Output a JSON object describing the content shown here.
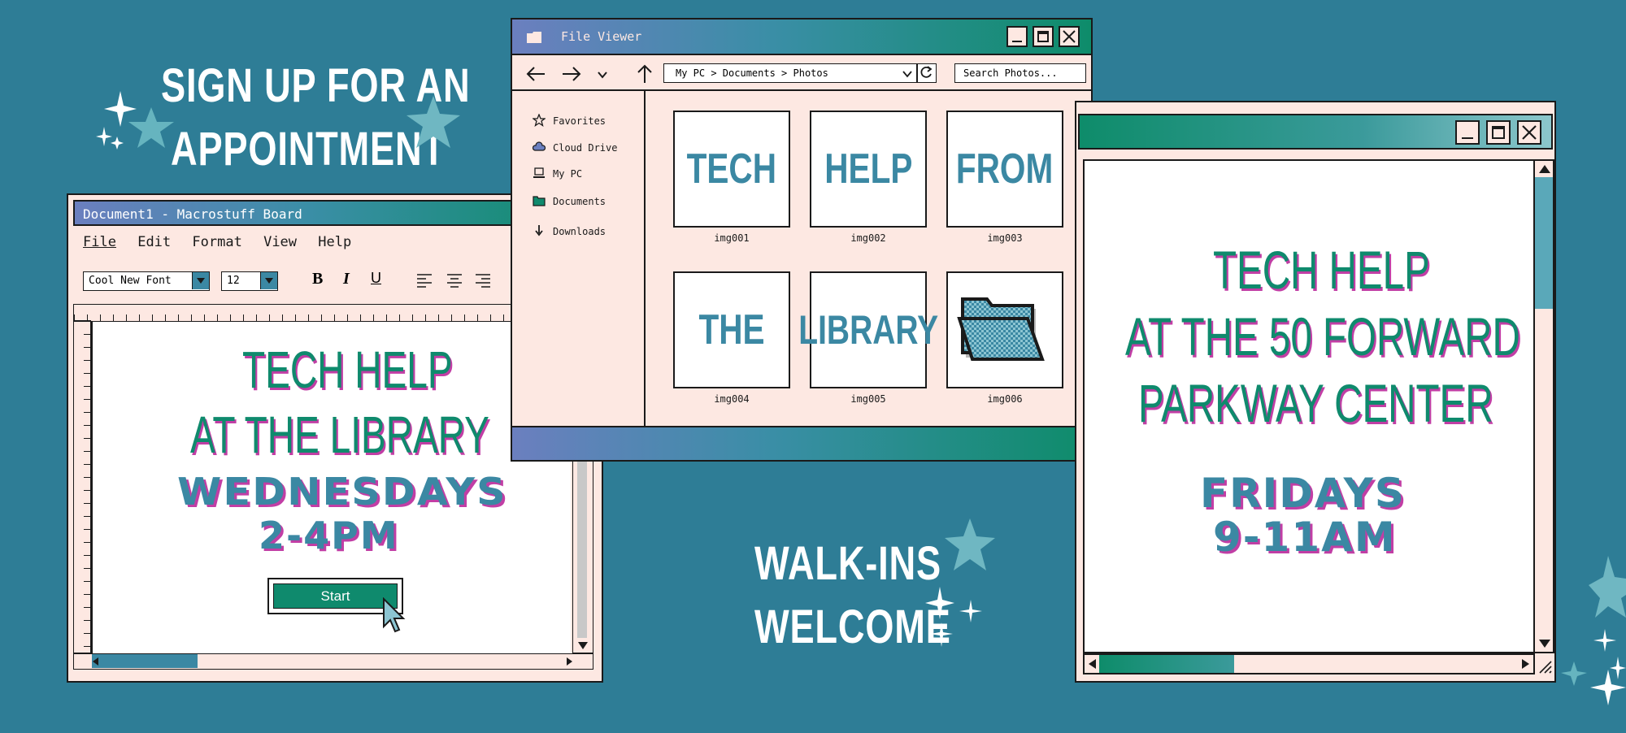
{
  "heading": {
    "line1": "SIGN UP FOR AN",
    "line2": "APPOINTMENT"
  },
  "walkins": {
    "line1": "WALK-INS",
    "line2": "WELCOME"
  },
  "doc_window": {
    "title": "Document1 - Macrostuff Board",
    "menu": [
      "File",
      "Edit",
      "Format",
      "View",
      "Help"
    ],
    "font_name": "Cool New Font",
    "font_size": "12",
    "bold": "B",
    "italic": "I",
    "underline": "U",
    "line1": "TECH HELP",
    "line2": "AT THE LIBRARY",
    "line3": "WEDNESDAYS",
    "line4": "2-4PM",
    "start_button": "Start"
  },
  "file_viewer": {
    "title": "File Viewer",
    "path": "My PC > Documents > Photos",
    "search_placeholder": "Search Photos...",
    "sidebar": [
      "Favorites",
      "Cloud Drive",
      "My PC",
      "Documents",
      "Downloads"
    ],
    "items": [
      {
        "text": "TECH",
        "caption": "img001"
      },
      {
        "text": "HELP",
        "caption": "img002"
      },
      {
        "text": "FROM",
        "caption": "img003"
      },
      {
        "text": "THE",
        "caption": "img004"
      },
      {
        "text": "LIBRARY",
        "caption": "img005"
      },
      {
        "text": "",
        "caption": "img006",
        "icon": "folder-icon"
      }
    ]
  },
  "right_window": {
    "line1": "TECH HELP",
    "line2": "AT THE 50 FORWARD",
    "line3": "PARKWAY CENTER",
    "line4": "FRIDAYS",
    "line5": "9-11AM"
  },
  "colors": {
    "background": "#2e7d96",
    "window": "#fde8e2",
    "accent_green": "#0f8a6d",
    "accent_magenta": "#c13ea5",
    "accent_blue": "#3b88a3"
  }
}
